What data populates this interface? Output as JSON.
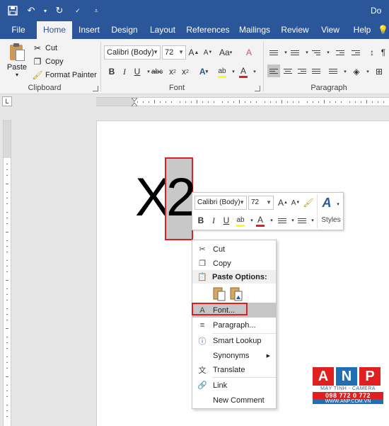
{
  "window": {
    "doc_title": "Do"
  },
  "tabs": [
    "File",
    "Home",
    "Insert",
    "Design",
    "Layout",
    "References",
    "Mailings",
    "Review",
    "View",
    "Help"
  ],
  "clipboard": {
    "paste_label": "Paste",
    "cut_label": "Cut",
    "copy_label": "Copy",
    "format_painter_label": "Format Painter",
    "group_label": "Clipboard"
  },
  "font": {
    "font_name": "Calibri (Body)",
    "font_size": "72",
    "grow_label": "A",
    "shrink_label": "A",
    "case_label": "Aa",
    "clear_label": "A",
    "bold": "B",
    "italic": "I",
    "underline": "U",
    "strike": "abc",
    "subscript": "x",
    "superscript": "x",
    "effects": "A",
    "highlight": "ab",
    "font_color": "A",
    "group_label": "Font"
  },
  "paragraph": {
    "group_label": "Paragraph"
  },
  "document": {
    "text_x": "X",
    "text_2": "2"
  },
  "mini_toolbar": {
    "font_name": "Calibri (Body)",
    "font_size": "72",
    "grow": "A",
    "shrink": "A",
    "bold": "B",
    "italic": "I",
    "underline": "U",
    "highlight": "ab",
    "font_color": "A",
    "styles_label": "Styles"
  },
  "context_menu": {
    "cut": "Cut",
    "copy": "Copy",
    "paste_options": "Paste Options:",
    "font": "Font...",
    "paragraph": "Paragraph...",
    "smart_lookup": "Smart Lookup",
    "synonyms": "Synonyms",
    "translate": "Translate",
    "link": "Link",
    "new_comment": "New Comment"
  },
  "watermark": {
    "letters": [
      "A",
      "N",
      "P"
    ],
    "subtitle": "MÁY TÍNH - CAMERA",
    "phone": "098 772 0 772",
    "website": "WWW.ANP.COM.VN"
  },
  "colors": {
    "accent": "#2b579a",
    "selection_outline": "#e02020",
    "anp_blue": "#1f6fb2",
    "highlight_yellow": "#ffff00",
    "font_red": "#e02020"
  }
}
